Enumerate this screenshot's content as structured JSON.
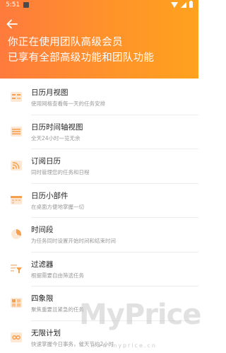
{
  "status_bar": {
    "time": "5:51"
  },
  "header": {
    "title_line1": "你正在使用团队高级会员",
    "title_line2": "已享有全部高级功能和团队功能"
  },
  "features": [
    {
      "label": "日历月视图",
      "desc": "使用网格查看每一天的任务安排",
      "icon": "calendar-month-icon"
    },
    {
      "label": "日历时间轴视图",
      "desc": "全天24小时一览无余",
      "icon": "calendar-timeline-icon"
    },
    {
      "label": "订阅日历",
      "desc": "同时管理您的任务和日程",
      "icon": "rss-subscribe-icon"
    },
    {
      "label": "日历小部件",
      "desc": "在桌面方便地掌握一切",
      "icon": "calendar-widget-icon"
    },
    {
      "label": "时间段",
      "desc": "为任务同时设置开始时间和结束时间",
      "icon": "time-range-icon"
    },
    {
      "label": "过滤器",
      "desc": "根据需要自由筛选任务",
      "icon": "filter-icon"
    },
    {
      "label": "四象限",
      "desc": "聚焦重要且紧急的任务",
      "icon": "quadrant-icon"
    },
    {
      "label": "无限计划",
      "desc": "快速掌握今日事务，催天节约2小时",
      "icon": "unlimited-plan-icon"
    }
  ],
  "watermark": {
    "text": "MyPrice",
    "sub": "www.myprice.cn"
  },
  "colors": {
    "header_start": "#ff7a3d",
    "header_end": "#ffa21d",
    "icon_accent": "#f6a04d"
  }
}
